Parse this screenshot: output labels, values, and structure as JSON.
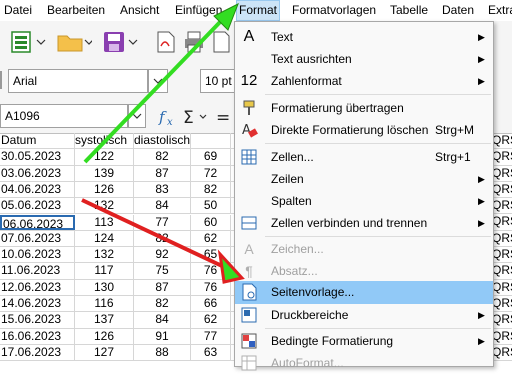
{
  "menubar": {
    "items": [
      "Datei",
      "Bearbeiten",
      "Ansicht",
      "Einfügen",
      "Format",
      "Formatvorlagen",
      "Tabelle",
      "Daten",
      "Extra"
    ]
  },
  "toolbar": {
    "font_name": "Arial",
    "font_size": "10 pt",
    "cell_ref": "A1096",
    "fx_icon": "function-icon",
    "sum_icon": "sum-icon"
  },
  "sheet": {
    "headers": [
      "Datum",
      "systolisch",
      "diastolisch",
      ""
    ],
    "rows": [
      [
        "30.05.2023",
        "122",
        "82",
        "69"
      ],
      [
        "03.06.2023",
        "139",
        "87",
        "72"
      ],
      [
        "04.06.2023",
        "126",
        "83",
        "82"
      ],
      [
        "05.06.2023",
        "132",
        "84",
        "50"
      ],
      [
        "06.06.2023",
        "113",
        "77",
        "60"
      ],
      [
        "07.06.2023",
        "124",
        "82",
        "62"
      ],
      [
        "10.06.2023",
        "132",
        "92",
        "65"
      ],
      [
        "11.06.2023",
        "117",
        "75",
        "76"
      ],
      [
        "12.06.2023",
        "130",
        "87",
        "76"
      ],
      [
        "14.06.2023",
        "116",
        "82",
        "66"
      ],
      [
        "15.06.2023",
        "137",
        "84",
        "62"
      ],
      [
        "16.06.2023",
        "126",
        "91",
        "77"
      ],
      [
        "17.06.2023",
        "127",
        "88",
        "63"
      ]
    ],
    "right_col": [
      "QRS",
      "QRS",
      "QRS",
      "QRS",
      "QRS",
      "QRS",
      "QRS",
      "QRS",
      "QRS",
      "QRS",
      "QRS",
      "QRS",
      "QRS",
      "QRS"
    ]
  },
  "format_menu": {
    "items": [
      {
        "label": "Text",
        "shortcut": "",
        "icon": "A",
        "submenu": true,
        "disabled": false
      },
      {
        "label": "Text ausrichten",
        "shortcut": "",
        "icon": "",
        "submenu": true,
        "disabled": false
      },
      {
        "label": "Zahlenformat",
        "shortcut": "",
        "icon": "12",
        "submenu": true,
        "disabled": false
      },
      {
        "label": "Formatierung übertragen",
        "shortcut": "",
        "icon": "brush",
        "submenu": false,
        "disabled": false
      },
      {
        "label": "Direkte Formatierung löschen",
        "shortcut": "Strg+M",
        "icon": "eraser",
        "submenu": false,
        "disabled": false
      },
      {
        "label": "Zellen...",
        "shortcut": "Strg+1",
        "icon": "cells",
        "submenu": false,
        "disabled": false
      },
      {
        "label": "Zeilen",
        "shortcut": "",
        "icon": "",
        "submenu": true,
        "disabled": false
      },
      {
        "label": "Spalten",
        "shortcut": "",
        "icon": "",
        "submenu": true,
        "disabled": false
      },
      {
        "label": "Zellen verbinden und trennen",
        "shortcut": "",
        "icon": "merge",
        "submenu": true,
        "disabled": false
      },
      {
        "label": "Zeichen...",
        "shortcut": "",
        "icon": "A",
        "submenu": false,
        "disabled": true
      },
      {
        "label": "Absatz...",
        "shortcut": "",
        "icon": "para",
        "submenu": false,
        "disabled": true
      },
      {
        "label": "Seitenvorlage...",
        "shortcut": "",
        "icon": "page",
        "submenu": false,
        "disabled": false,
        "highlighted": true
      },
      {
        "label": "Druckbereiche",
        "shortcut": "",
        "icon": "print",
        "submenu": true,
        "disabled": false
      },
      {
        "label": "Bedingte Formatierung",
        "shortcut": "",
        "icon": "cond",
        "submenu": true,
        "disabled": false
      },
      {
        "label": "AutoFormat...",
        "shortcut": "",
        "icon": "auto",
        "submenu": false,
        "disabled": true
      }
    ]
  },
  "colors": {
    "highlight": "#91c9f7",
    "green_arrow": "#33dd22",
    "red_arrow": "#e02020"
  }
}
